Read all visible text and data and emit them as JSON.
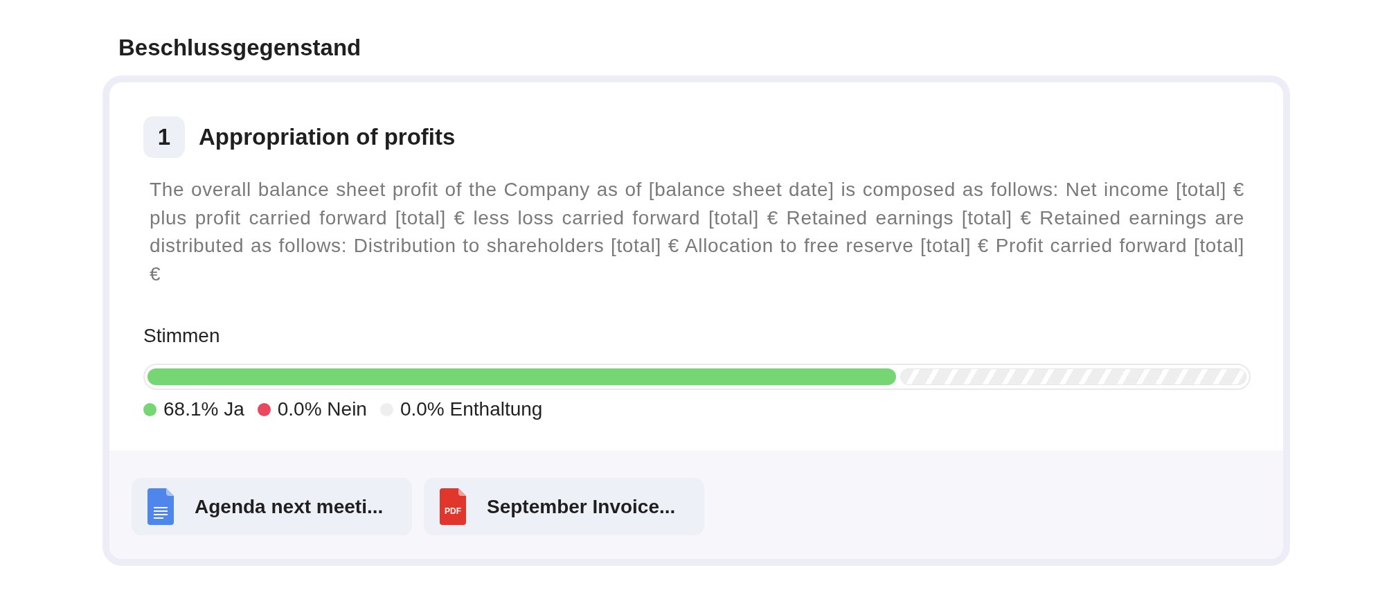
{
  "section_title": "Beschlussgegenstand",
  "item": {
    "number": "1",
    "title": "Appropriation of profits",
    "description": "The overall balance sheet profit of the Company as of [balance sheet date] is composed as follows: Net income [total] € plus profit carried forward [total] € less loss carried forward [total] € Retained earnings [total] € Retained earnings are distributed as follows: Distribution to shareholders [total] € Allocation to free reserve [total] € Profit carried forward [total] €",
    "votes": {
      "label": "Stimmen",
      "level": 0.681,
      "legend": [
        {
          "text": "68.1% Ja",
          "color": "#77d674"
        },
        {
          "text": "0.0% Nein",
          "color": "#ea4660"
        },
        {
          "text": "0.0% Enthaltung",
          "color": "#eeeeee"
        }
      ]
    }
  },
  "attachments": [
    {
      "kind": "document",
      "name": "Agenda next meeti..."
    },
    {
      "kind": "pdf",
      "name": "September Invoice...",
      "icon_label": "PDF"
    }
  ]
}
